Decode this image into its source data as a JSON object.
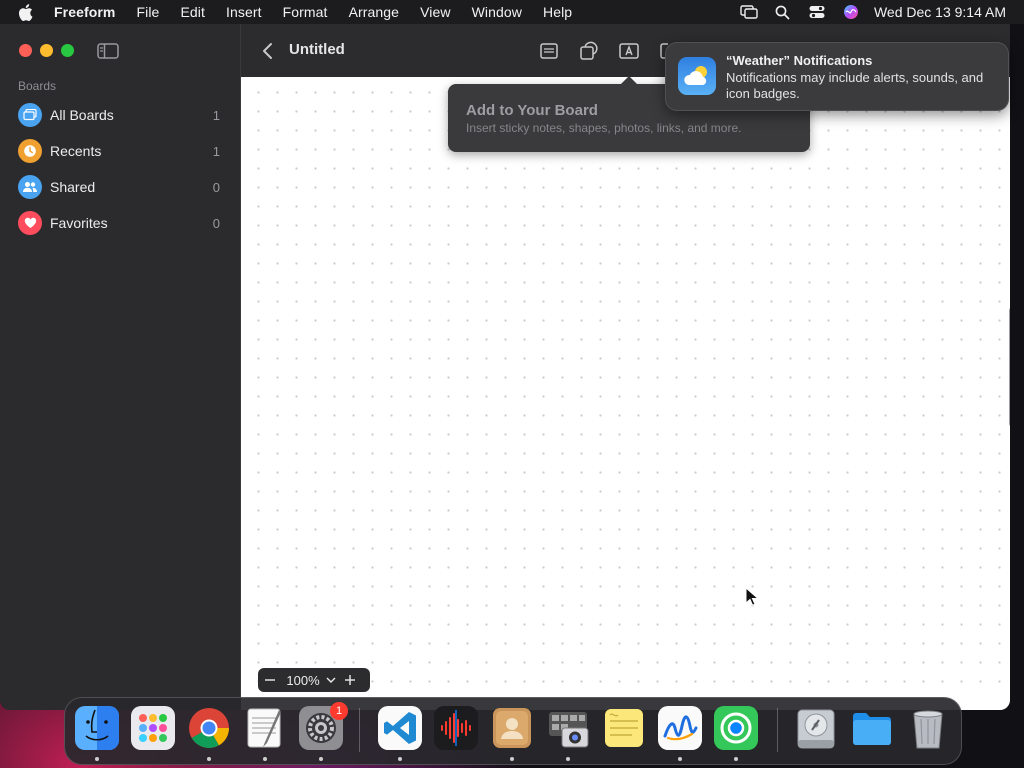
{
  "menubar": {
    "app": "Freeform",
    "items": [
      "File",
      "Edit",
      "Insert",
      "Format",
      "Arrange",
      "View",
      "Window",
      "Help"
    ],
    "clock": "Wed Dec 13  9:14 AM"
  },
  "sidebar": {
    "section": "Boards",
    "items": [
      {
        "label": "All Boards",
        "count": "1"
      },
      {
        "label": "Recents",
        "count": "1"
      },
      {
        "label": "Shared",
        "count": "0"
      },
      {
        "label": "Favorites",
        "count": "0"
      }
    ]
  },
  "toolbar": {
    "title": "Untitled"
  },
  "tooltip": {
    "title": "Add to Your Board",
    "body": "Insert sticky notes, shapes, photos, links, and more."
  },
  "zoom": {
    "value": "100%"
  },
  "notification": {
    "title": "“Weather” Notifications",
    "body": "Notifications may include alerts, sounds, and icon badges."
  },
  "dock": {
    "apps": [
      "Finder",
      "Launchpad",
      "Google Chrome",
      "TextEdit",
      "System Settings",
      "Visual Studio Code",
      "Voice Memos",
      "Contacts",
      "Image Capture",
      "Stickies",
      "Freeform",
      "Find My",
      "Disk Utility",
      "Files",
      "Trash"
    ],
    "settings_badge": "1"
  },
  "colors": {
    "accent_blue": "#4aa3f0",
    "recents_orange": "#f0a030",
    "favorites_red": "#ff4d5e"
  }
}
